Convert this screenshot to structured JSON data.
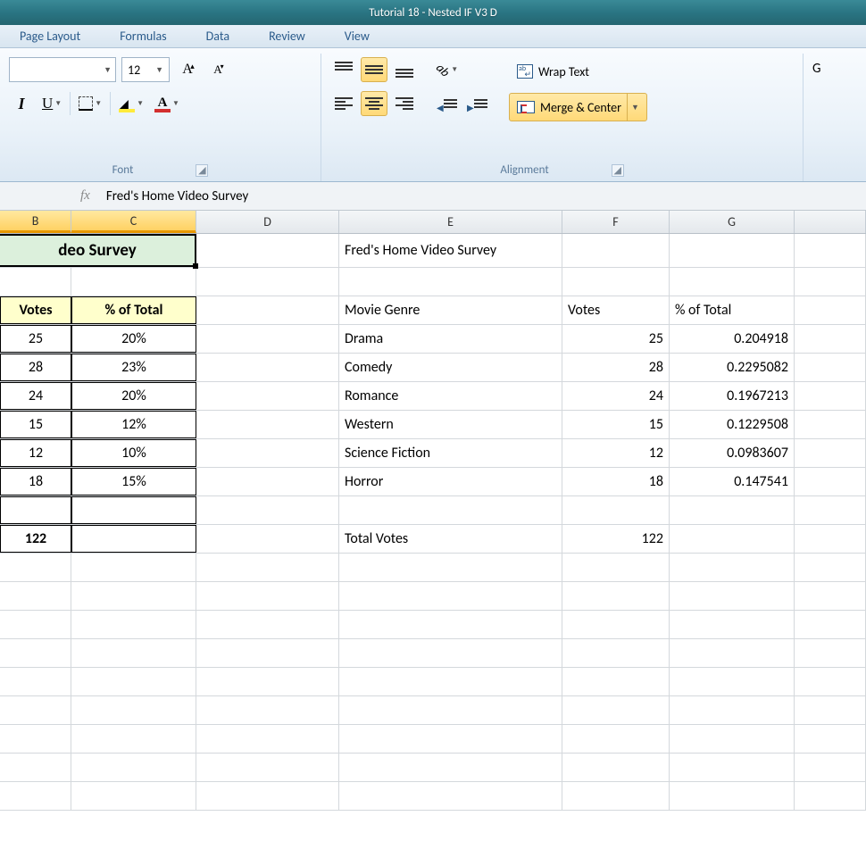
{
  "title": "Tutorial 18 - Nested IF V3 D",
  "tabs": [
    "Page Layout",
    "Formulas",
    "Data",
    "Review",
    "View"
  ],
  "ribbon": {
    "font_size": "12",
    "group_font": "Font",
    "group_align": "Alignment",
    "wrap_text": "Wrap Text",
    "merge_center": "Merge & Center",
    "number_hint": "G"
  },
  "formula_bar": {
    "fx": "fx",
    "value": "Fred's Home Video Survey"
  },
  "columns": [
    "B",
    "C",
    "D",
    "E",
    "F",
    "G"
  ],
  "left_table": {
    "title": "deo Survey",
    "headers": [
      "Votes",
      "% of Total"
    ],
    "rows": [
      {
        "votes": "25",
        "pct": "20%"
      },
      {
        "votes": "28",
        "pct": "23%"
      },
      {
        "votes": "24",
        "pct": "20%"
      },
      {
        "votes": "15",
        "pct": "12%"
      },
      {
        "votes": "12",
        "pct": "10%"
      },
      {
        "votes": "18",
        "pct": "15%"
      }
    ],
    "total": "122"
  },
  "right_table": {
    "title": "Fred's Home Video Survey",
    "headers": [
      "Movie Genre",
      "Votes",
      "% of Total"
    ],
    "rows": [
      {
        "genre": "Drama",
        "votes": "25",
        "pct": "0.204918"
      },
      {
        "genre": "Comedy",
        "votes": "28",
        "pct": "0.2295082"
      },
      {
        "genre": "Romance",
        "votes": "24",
        "pct": "0.1967213"
      },
      {
        "genre": "Western",
        "votes": "15",
        "pct": "0.1229508"
      },
      {
        "genre": "Science Fiction",
        "votes": "12",
        "pct": "0.0983607"
      },
      {
        "genre": "Horror",
        "votes": "18",
        "pct": "0.147541"
      }
    ],
    "total_label": "Total Votes",
    "total": "122"
  },
  "chart_data": {
    "type": "table",
    "title": "Fred's Home Video Survey",
    "categories": [
      "Drama",
      "Comedy",
      "Romance",
      "Western",
      "Science Fiction",
      "Horror"
    ],
    "series": [
      {
        "name": "Votes",
        "values": [
          25,
          28,
          24,
          15,
          12,
          18
        ]
      },
      {
        "name": "% of Total",
        "values": [
          0.204918,
          0.2295082,
          0.1967213,
          0.1229508,
          0.0983607,
          0.147541
        ]
      }
    ],
    "total_votes": 122
  }
}
